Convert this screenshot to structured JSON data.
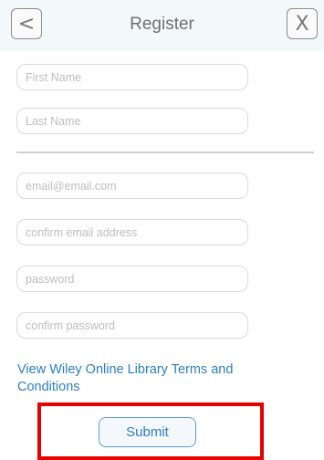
{
  "header": {
    "title": "Register",
    "back_icon": "<",
    "close_icon": "X"
  },
  "form": {
    "first_name": {
      "placeholder": "First Name",
      "value": ""
    },
    "last_name": {
      "placeholder": "Last Name",
      "value": ""
    },
    "email": {
      "placeholder": "email@email.com",
      "value": ""
    },
    "confirm_email": {
      "placeholder": "confirm email address",
      "value": ""
    },
    "password": {
      "placeholder": "password",
      "value": ""
    },
    "confirm_password": {
      "placeholder": "confirm password",
      "value": ""
    },
    "terms_link": "View Wiley Online Library Terms and Conditions",
    "submit_label": "Submit"
  },
  "colors": {
    "link": "#2a7ec4",
    "highlight": "#e60000",
    "header_background": "#f3f8fb"
  }
}
